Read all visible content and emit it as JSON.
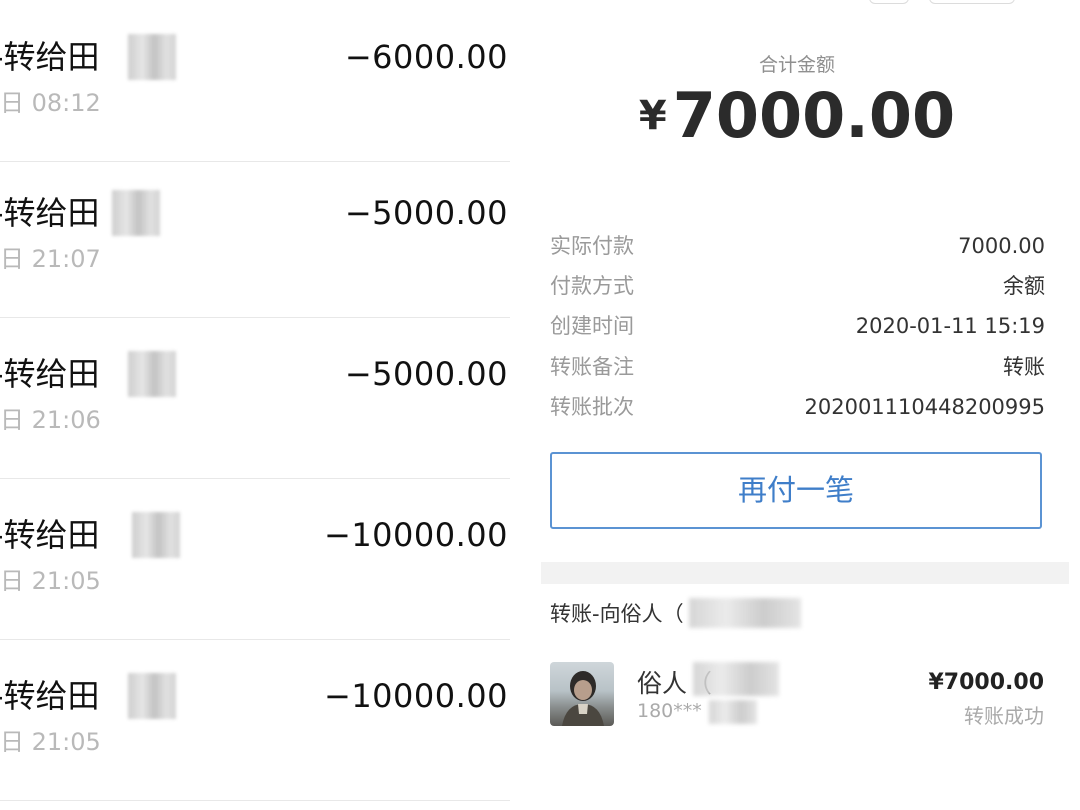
{
  "transactions": [
    {
      "title": "-转给田",
      "amount": "−6000.00",
      "date": "日 08:12"
    },
    {
      "title": "-转给田",
      "amount": "−5000.00",
      "date": "日 21:07"
    },
    {
      "title": "-转给田",
      "amount": "−5000.00",
      "date": "日 21:06"
    },
    {
      "title": "-转给田",
      "amount": "−10000.00",
      "date": "日 21:05"
    },
    {
      "title": "-转给田",
      "amount": "−10000.00",
      "date": "日 21:05"
    }
  ],
  "summary": {
    "total_label": "合计金额",
    "currency_symbol": "¥",
    "total_amount": "7000.00"
  },
  "details": [
    {
      "label": "实际付款",
      "value": "7000.00"
    },
    {
      "label": "付款方式",
      "value": "余额"
    },
    {
      "label": "创建时间",
      "value": "2020-01-11 15:19"
    },
    {
      "label": "转账备注",
      "value": "转账"
    },
    {
      "label": "转账批次",
      "value": "20200111044820099​5"
    }
  ],
  "actions": {
    "repay_label": "再付一笔"
  },
  "recipient": {
    "section_title": "转账-向俗人（",
    "name": "俗人（",
    "phone": "180***",
    "amount": "¥7000.00",
    "status": "转账成功"
  },
  "colors": {
    "accent_blue": "#3f7ec9",
    "muted_text": "#9a9a9a",
    "divider": "#f2f2f2"
  }
}
